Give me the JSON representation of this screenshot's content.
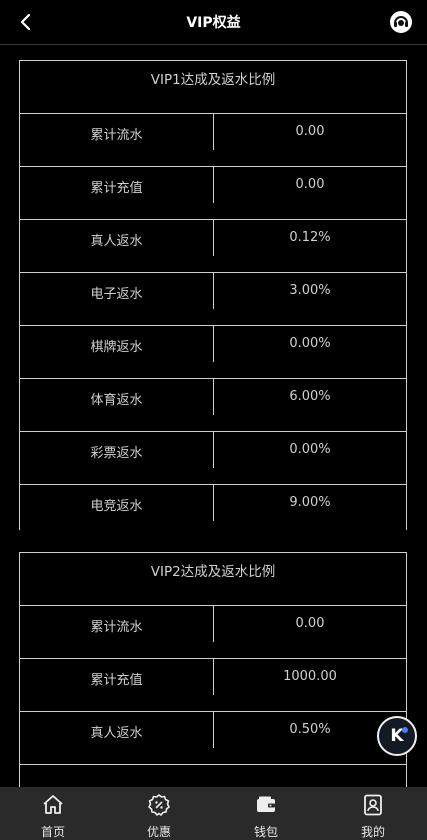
{
  "header": {
    "title": "VIP权益"
  },
  "tables": [
    {
      "title": "VIP1达成及返水比例",
      "rows": [
        {
          "label": "累计流水",
          "value": "0.00"
        },
        {
          "label": "累计充值",
          "value": "0.00"
        },
        {
          "label": "真人返水",
          "value": "0.12%"
        },
        {
          "label": "电子返水",
          "value": "3.00%"
        },
        {
          "label": "棋牌返水",
          "value": "0.00%"
        },
        {
          "label": "体育返水",
          "value": "6.00%"
        },
        {
          "label": "彩票返水",
          "value": "0.00%"
        },
        {
          "label": "电竞返水",
          "value": "9.00%"
        }
      ]
    },
    {
      "title": "VIP2达成及返水比例",
      "rows": [
        {
          "label": "累计流水",
          "value": "0.00"
        },
        {
          "label": "累计充值",
          "value": "1000.00"
        },
        {
          "label": "真人返水",
          "value": "0.50%"
        }
      ]
    }
  ],
  "float_button": {
    "letter": "K"
  },
  "tabbar": {
    "items": [
      {
        "label": "首页",
        "icon": "home-icon"
      },
      {
        "label": "优惠",
        "icon": "discount-icon"
      },
      {
        "label": "钱包",
        "icon": "wallet-icon"
      },
      {
        "label": "我的",
        "icon": "profile-icon"
      }
    ]
  }
}
